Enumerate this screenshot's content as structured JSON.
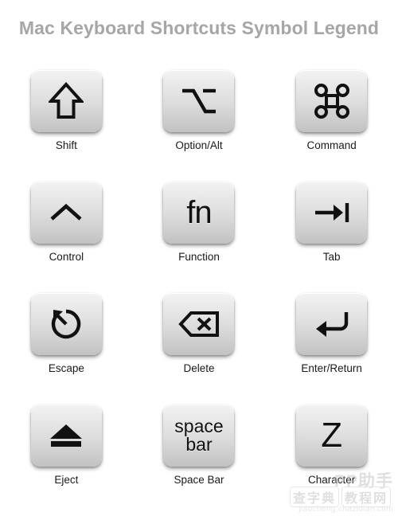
{
  "title": "Mac Keyboard Shortcuts Symbol Legend",
  "colors": {
    "title": "#a6a6a6",
    "label": "#1a1a1a",
    "key_top": "#f3f3f3",
    "key_bottom": "#c2c2c2",
    "glyph": "#111111",
    "background": "#ffffff",
    "watermark": "#b9b9b9"
  },
  "keys": [
    {
      "id": "shift",
      "label": "Shift",
      "glyph_name": "shift-arrow-icon",
      "glyph_char": "⇧",
      "glyph_type": "svg"
    },
    {
      "id": "option",
      "label": "Option/Alt",
      "glyph_name": "option-alt-icon",
      "glyph_char": "⌥",
      "glyph_type": "svg"
    },
    {
      "id": "command",
      "label": "Command",
      "glyph_name": "command-icon",
      "glyph_char": "⌘",
      "glyph_type": "svg"
    },
    {
      "id": "control",
      "label": "Control",
      "glyph_name": "control-caret-icon",
      "glyph_char": "⌃",
      "glyph_type": "svg"
    },
    {
      "id": "function",
      "label": "Function",
      "glyph_name": "function-fn-icon",
      "glyph_char": "fn",
      "glyph_type": "text"
    },
    {
      "id": "tab",
      "label": "Tab",
      "glyph_name": "tab-arrow-icon",
      "glyph_char": "⇥",
      "glyph_type": "svg"
    },
    {
      "id": "escape",
      "label": "Escape",
      "glyph_name": "escape-circle-arrow-icon",
      "glyph_char": "⎋",
      "glyph_type": "svg"
    },
    {
      "id": "delete",
      "label": "Delete",
      "glyph_name": "delete-backspace-icon",
      "glyph_char": "⌫",
      "glyph_type": "svg"
    },
    {
      "id": "enter",
      "label": "Enter/Return",
      "glyph_name": "return-arrow-icon",
      "glyph_char": "↵",
      "glyph_type": "svg"
    },
    {
      "id": "eject",
      "label": "Eject",
      "glyph_name": "eject-icon",
      "glyph_char": "⏏",
      "glyph_type": "svg"
    },
    {
      "id": "space",
      "label": "Space Bar",
      "glyph_name": "space-bar-text-icon",
      "glyph_char": "space bar",
      "glyph_line1": "space",
      "glyph_line2": "bar",
      "glyph_type": "text2"
    },
    {
      "id": "character",
      "label": "Character",
      "glyph_name": "character-z-icon",
      "glyph_char": "Z",
      "glyph_type": "text"
    }
  ],
  "watermark": {
    "line1": "PP助手",
    "line2_left": "查字典",
    "line2_right": "教程网",
    "line3": "jiaocheng.chazidian.com"
  }
}
